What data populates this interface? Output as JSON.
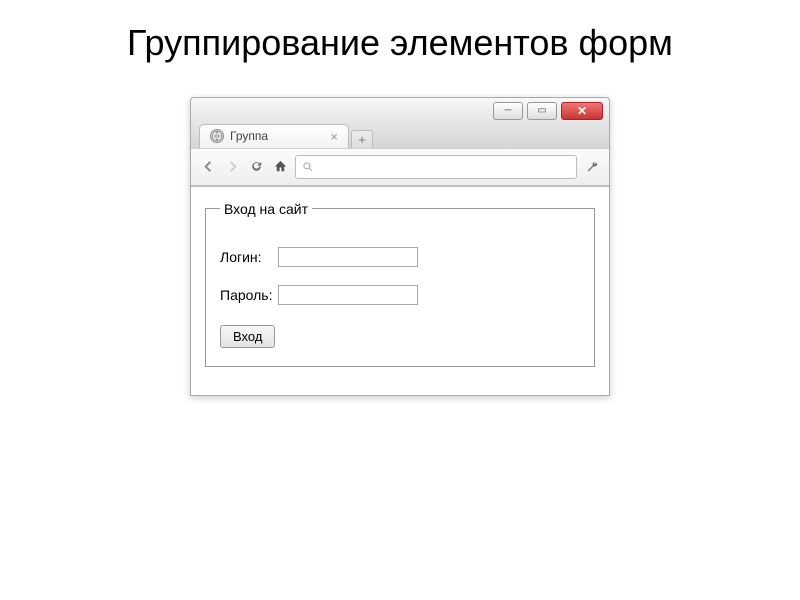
{
  "slide": {
    "title": "Группирование элементов форм"
  },
  "browser": {
    "tab_title": "Группа"
  },
  "form": {
    "legend": "Вход на сайт",
    "login_label": "Логин:",
    "password_label": "Пароль:",
    "submit_label": "Вход"
  }
}
